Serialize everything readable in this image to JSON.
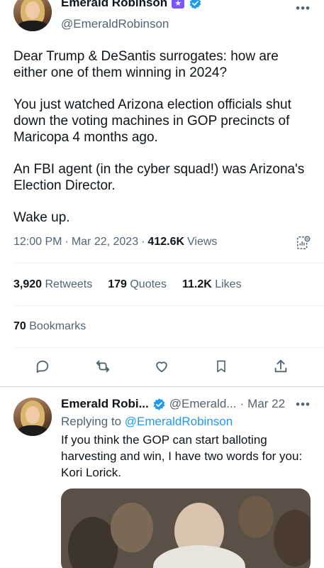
{
  "main_tweet": {
    "author_name": "Emerald Robinson",
    "author_handle": "@EmeraldRobinson",
    "badge_label": "",
    "text": [
      "Dear Trump & DeSantis surrogates: how are either one of them winning in 2024?",
      "You just watched Arizona election officials shut down the voting machines in GOP precincts of Maricopa 4 months ago.",
      "An FBI agent (in the cyber squad!) was Arizona's Election Director.",
      "Wake up."
    ],
    "time": "12:00 PM",
    "date": "Mar 22, 2023",
    "views_count": "412.6K",
    "views_label": "Views",
    "stats": {
      "retweets_count": "3,920",
      "retweets_label": "Retweets",
      "quotes_count": "179",
      "quotes_label": "Quotes",
      "likes_count": "11.2K",
      "likes_label": "Likes",
      "bookmarks_count": "70",
      "bookmarks_label": "Bookmarks"
    },
    "actions": [
      "reply-icon",
      "retweet-icon",
      "like-icon",
      "bookmark-icon",
      "share-icon"
    ]
  },
  "reply_tweet": {
    "author_name": "Emerald Robi...",
    "author_handle": "@Emerald...",
    "date": "Mar 22",
    "replying_prefix": "Replying to",
    "replying_to": "@EmeraldRobinson",
    "text": "If you think the GOP can start balloting harvesting and win, I have two words for you: Kori Lorick."
  },
  "colors": {
    "text": "#0f1419",
    "secondary": "#536471",
    "link": "#1d9bf0",
    "verified": "#1d9bf0",
    "badge": "#7856ff"
  }
}
